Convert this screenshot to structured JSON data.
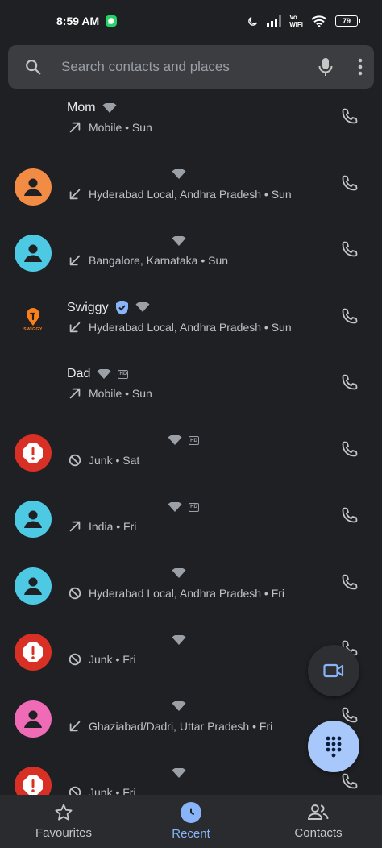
{
  "status_bar": {
    "time": "8:59 AM",
    "volte_top": "Vo",
    "volte_bottom": "WiFi",
    "battery": "79"
  },
  "search": {
    "placeholder": "Search contacts and places"
  },
  "calls": [
    {
      "name": "Mom",
      "direction": "outgoing",
      "detail": "Mobile • Sun",
      "avatar": "none",
      "badges": [
        "wifi"
      ]
    },
    {
      "name": "",
      "direction": "incoming",
      "detail": "Hyderabad Local, Andhra Pradesh • Sun",
      "avatar": "person",
      "avatar_color": "#f28b44",
      "badges": [
        "wifi"
      ]
    },
    {
      "name": "",
      "direction": "incoming",
      "detail": "Bangalore, Karnataka • Sun",
      "avatar": "person",
      "avatar_color": "#4ec9e4",
      "badges": [
        "wifi"
      ]
    },
    {
      "name": "Swiggy",
      "direction": "incoming",
      "detail": "Hyderabad Local, Andhra Pradesh • Sun",
      "avatar": "swiggy",
      "avatar_text": "SWIGGY",
      "badges": [
        "verified",
        "wifi"
      ]
    },
    {
      "name": "Dad",
      "direction": "outgoing",
      "detail": "Mobile • Sun",
      "avatar": "none",
      "badges": [
        "wifi",
        "hd"
      ]
    },
    {
      "name": "",
      "direction": "blocked",
      "detail": "Junk • Sat",
      "avatar": "spam",
      "avatar_color": "#d93025",
      "badges": [
        "wifi",
        "hd"
      ]
    },
    {
      "name": "",
      "direction": "outgoing",
      "detail": "India • Fri",
      "avatar": "person",
      "avatar_color": "#4ec9e4",
      "badges": [
        "wifi",
        "hd"
      ]
    },
    {
      "name": "",
      "direction": "blocked",
      "detail": "Hyderabad Local, Andhra Pradesh • Fri",
      "avatar": "person",
      "avatar_color": "#4ec9e4",
      "badges": [
        "wifi"
      ]
    },
    {
      "name": "",
      "direction": "blocked",
      "detail": "Junk • Fri",
      "avatar": "spam",
      "avatar_color": "#d93025",
      "badges": [
        "wifi"
      ]
    },
    {
      "name": "",
      "direction": "incoming",
      "detail": "Ghaziabad/Dadri, Uttar Pradesh • Fri",
      "avatar": "person",
      "avatar_color": "#f06bb5",
      "badges": [
        "wifi"
      ]
    },
    {
      "name": "",
      "direction": "blocked",
      "detail": "Junk • Fri",
      "avatar": "spam",
      "avatar_color": "#d93025",
      "badges": [
        "wifi"
      ]
    }
  ],
  "nav": {
    "items": [
      {
        "label": "Favourites",
        "icon": "star-icon",
        "active": false
      },
      {
        "label": "Recent",
        "icon": "clock-icon",
        "active": true
      },
      {
        "label": "Contacts",
        "icon": "contacts-icon",
        "active": false
      }
    ]
  },
  "colors": {
    "accent": "#8ab4f8",
    "fab": "#a8c7fa",
    "background": "#1f2023"
  }
}
